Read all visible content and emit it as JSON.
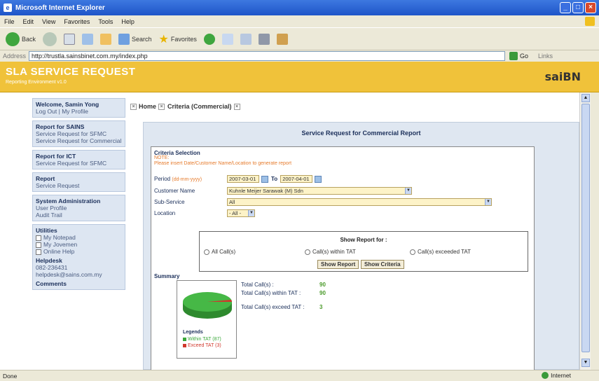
{
  "window": {
    "title": "Microsoft Internet Explorer"
  },
  "menu": [
    "File",
    "Edit",
    "View",
    "Favorites",
    "Tools",
    "Help"
  ],
  "toolbar": {
    "back": "Back",
    "search": "Search",
    "favorites": "Favorites"
  },
  "address": {
    "label": "Address",
    "url": "http://trustla.sainsbinet.com.my/index.php",
    "go": "Go",
    "links": "Links"
  },
  "banner": {
    "title": "SLA SERVICE REQUEST",
    "subtitle": "Reporting Environment v1.0",
    "logo": "saiBN"
  },
  "sidebar": {
    "welcome": "Welcome, Samin Yong",
    "logout": "Log Out | ",
    "myprofile": "My Profile",
    "sections": [
      {
        "title": "Report for SAINS",
        "items": [
          "Service Request for SFMC",
          "Service Request for Commercial"
        ]
      },
      {
        "title": "Report for ICT",
        "items": [
          "Service Request for SFMC"
        ]
      },
      {
        "title": "Report",
        "items": [
          "Service Request"
        ]
      },
      {
        "title": "System Administration",
        "items": [
          "User Profile",
          "Audit Trail"
        ]
      }
    ],
    "utilities": {
      "title": "Utilities",
      "items": [
        "My Notepad",
        "My Jovemen",
        "Online Help"
      ]
    },
    "helpdesk": {
      "title": "Helpdesk",
      "phone": "082-236431",
      "email": "helpdesk@sains.com.my"
    },
    "comments": "Comments"
  },
  "tabs": [
    "Home",
    "Criteria (Commercial)"
  ],
  "panel": {
    "title": "Service Request for Commercial Report",
    "criteria": {
      "heading": "Criteria Selection",
      "note1": "NOTE:",
      "note2": "Please insert Date/Customer Name/Location to generate report",
      "period_label": "Period",
      "period_hint": "(dd-mm-yyyy)",
      "period_from": "2007-03-01",
      "period_to_label": "To",
      "period_to": "2007-04-01",
      "customer_label": "Customer Name",
      "customer_value": "Kuhnle Meijer Sarawak (M) Sdn",
      "sub_label": "Sub-Service",
      "sub_value": "All",
      "location_label": "Location",
      "location_value": "- All -"
    },
    "show": {
      "title": "Show Report for :",
      "options": [
        "All Call(s)",
        "Call(s) within TAT",
        "Call(s) exceeded TAT"
      ],
      "btn_report": "Show Report",
      "btn_criteria": "Show Criteria"
    },
    "summary": {
      "title": "Summary",
      "legend_title": "Legends",
      "legend": [
        {
          "label": "Within TAT (87)",
          "color": "#3aa83a"
        },
        {
          "label": "Exceed TAT (3)",
          "color": "#d0382c"
        }
      ],
      "stats": [
        {
          "label": "Total Call(s) :",
          "value": "90"
        },
        {
          "label": "Total Call(s) within TAT :",
          "value": "90"
        },
        {
          "label": "Total Call(s) exceed TAT :",
          "value": "3"
        }
      ]
    }
  },
  "status": {
    "left": "Done",
    "zone": "Internet"
  }
}
